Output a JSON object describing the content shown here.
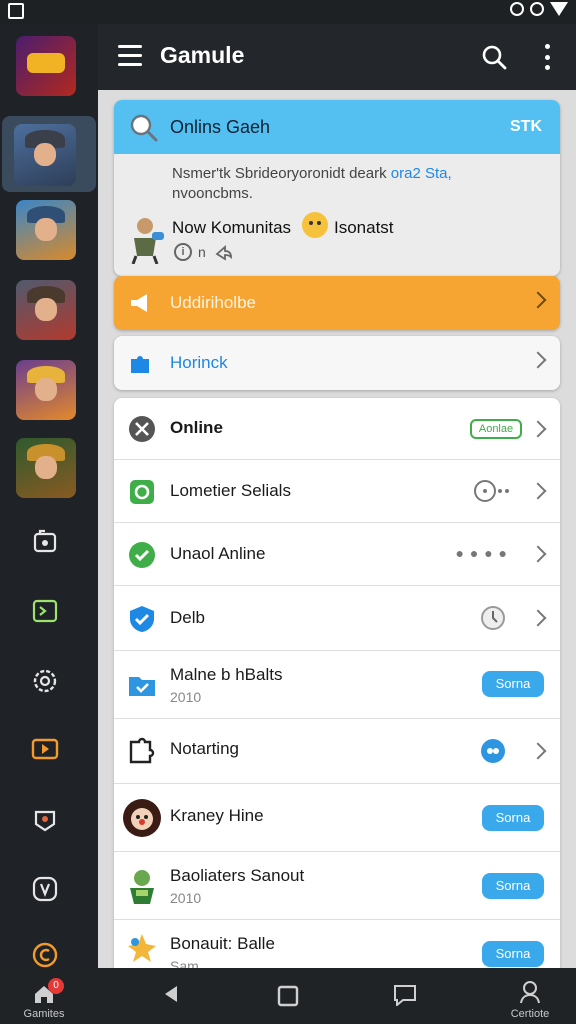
{
  "app_bar": {
    "title": "Gamule"
  },
  "search_card": {
    "search_text": "Onlins Gaeh",
    "search_right": "STK",
    "description": "Nsmer'tk Sbrideoryoronidt deark",
    "description_link": "ora2 Sta,",
    "description_line2": "nvooncbms.",
    "community_label": "Now Komunitas",
    "community_value": "Isonatst",
    "info_text": "n"
  },
  "banners": {
    "orange_label": "Uddiriholbe",
    "white_label": "Horinck"
  },
  "list": [
    {
      "title": "Online",
      "badge": "Aonlae"
    },
    {
      "title": "Lometier Selials"
    },
    {
      "title": "Unaol Anline"
    },
    {
      "title": "Delb"
    },
    {
      "title": "Malne b hBalts",
      "subtitle": "2010",
      "button": "Sorna"
    },
    {
      "title": "Notarting"
    },
    {
      "title": "Kraney Hine",
      "button": "Sorna"
    },
    {
      "title": "Baoliaters Sanout",
      "subtitle": "2010",
      "button": "Sorna"
    },
    {
      "title": "Bonauit: Balle",
      "subtitle": "Sam",
      "button": "Sorna"
    }
  ],
  "bottom_nav": {
    "home_label": "Gamites",
    "home_badge": "0",
    "profile_label": "Certiote"
  },
  "icons": [
    "menu-icon",
    "search-icon",
    "more-icon",
    "home-icon",
    "back-icon",
    "recents-icon",
    "chat-icon",
    "profile-icon"
  ],
  "colors": {
    "accent_blue": "#53c0f1",
    "banner_orange": "#f7a532",
    "button_blue": "#3aa9ec",
    "online_green": "#3fae49",
    "rail_bg": "#1f2327"
  }
}
